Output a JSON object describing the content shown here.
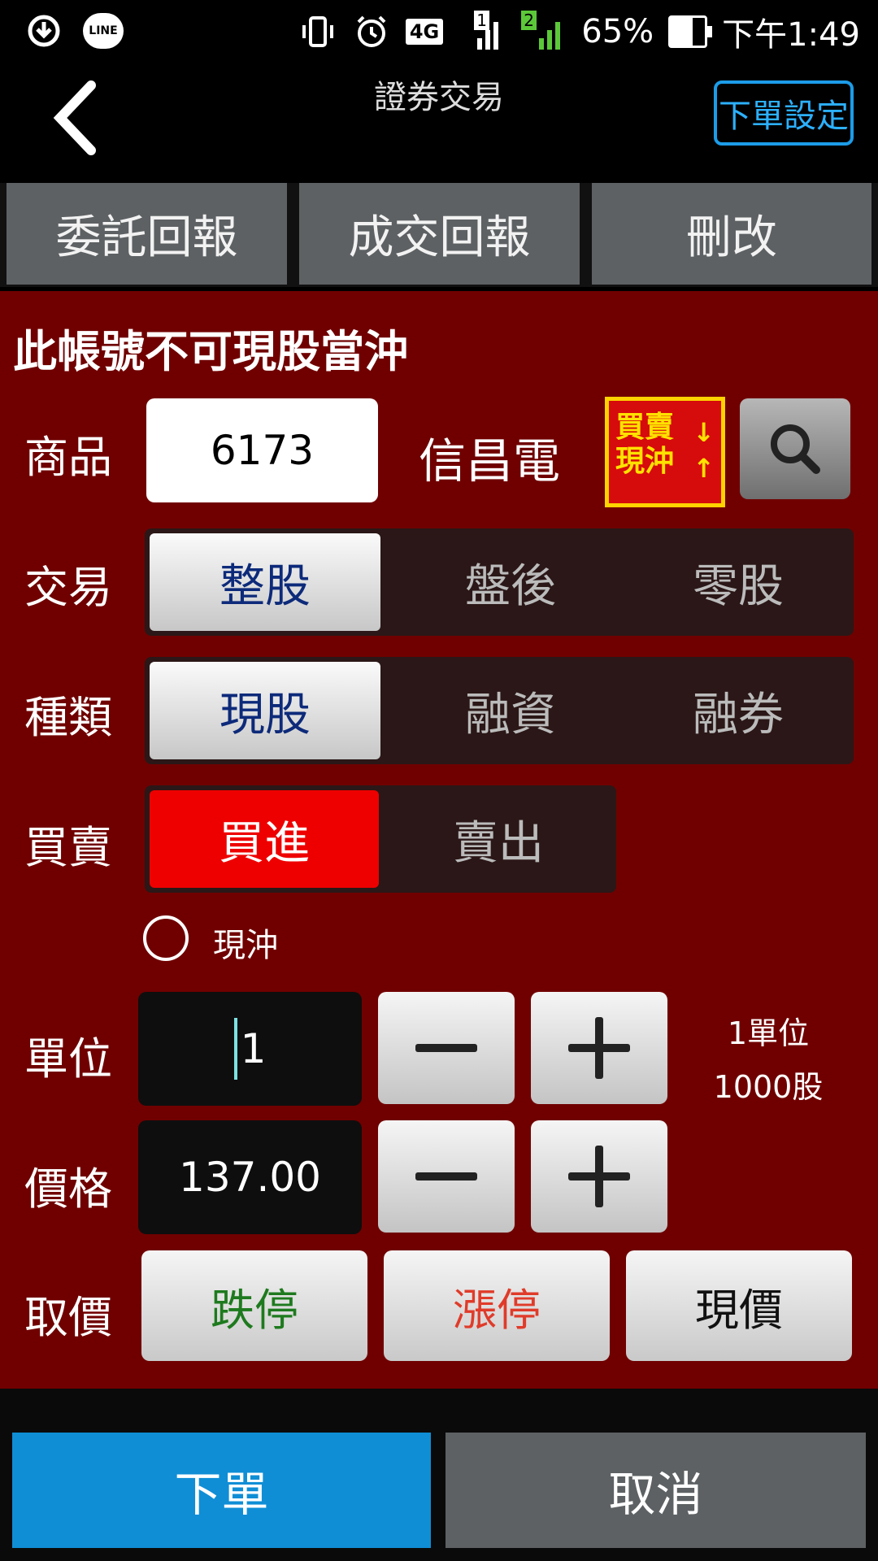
{
  "status_bar": {
    "line_label": "LINE",
    "network": "4G",
    "sim1_label": "1",
    "sim2_label": "2",
    "battery": "65%",
    "battery_level": 0.65,
    "time": "下午1:49"
  },
  "header": {
    "title": "證券交易",
    "settings_label": "下單設定"
  },
  "tabs": [
    {
      "label": "委託回報"
    },
    {
      "label": "成交回報"
    },
    {
      "label": "刪改"
    }
  ],
  "form": {
    "notice": "此帳號不可現股當沖",
    "product_label": "商品",
    "product_code": "6173",
    "product_name": "信昌電",
    "daytrade_icon_text": [
      "買賣",
      "現沖"
    ],
    "trade_label": "交易",
    "trade_options": [
      "整股",
      "盤後",
      "零股"
    ],
    "trade_selected": 0,
    "type_label": "種類",
    "type_options": [
      "現股",
      "融資",
      "融券"
    ],
    "type_selected": 0,
    "side_label": "買賣",
    "side_options": [
      "買進",
      "賣出"
    ],
    "side_selected": 0,
    "daytrade_radio_label": "現沖",
    "unit_label": "單位",
    "unit_value": "1",
    "unit_info_line1": "1單位",
    "unit_info_line2": "1000股",
    "price_label": "價格",
    "price_value": "137.00",
    "quote_label": "取價",
    "quote_buttons": [
      {
        "label": "跌停",
        "color": "#1e7a1e"
      },
      {
        "label": "漲停",
        "color": "#e03b2a"
      },
      {
        "label": "現價",
        "color": "#111111"
      }
    ]
  },
  "bottom": {
    "order_label": "下單",
    "cancel_label": "取消"
  },
  "colors": {
    "form_bg": "#700000",
    "order_btn": "#0f8ed6",
    "accent_blue": "#1c9ce8",
    "selected_red": "#ee0000"
  }
}
